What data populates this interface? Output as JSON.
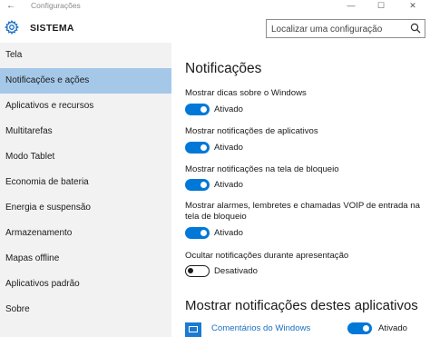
{
  "window": {
    "back_glyph": "←",
    "title": "Configurações",
    "minimize": "—",
    "maximize": "☐",
    "close": "✕"
  },
  "header": {
    "section": "SISTEMA",
    "search_placeholder": "Localizar uma configuração"
  },
  "sidebar": {
    "items": [
      {
        "label": "Tela"
      },
      {
        "label": "Notificações e ações"
      },
      {
        "label": "Aplicativos e recursos"
      },
      {
        "label": "Multitarefas"
      },
      {
        "label": "Modo Tablet"
      },
      {
        "label": "Economia de bateria"
      },
      {
        "label": "Energia e suspensão"
      },
      {
        "label": "Armazenamento"
      },
      {
        "label": "Mapas offline"
      },
      {
        "label": "Aplicativos padrão"
      },
      {
        "label": "Sobre"
      }
    ],
    "selected": "Notificações e ações"
  },
  "main": {
    "heading": "Notificações",
    "options": [
      {
        "label": "Mostrar dicas sobre o Windows",
        "state": "Ativado",
        "on": true
      },
      {
        "label": "Mostrar notificações de aplicativos",
        "state": "Ativado",
        "on": true
      },
      {
        "label": "Mostrar notificações na tela de bloqueio",
        "state": "Ativado",
        "on": true
      },
      {
        "label": "Mostrar alarmes, lembretes e chamadas VOIP de entrada na tela de bloqueio",
        "state": "Ativado",
        "on": true
      },
      {
        "label": "Ocultar notificações durante apresentação",
        "state": "Desativado",
        "on": false
      }
    ],
    "apps_heading": "Mostrar notificações destes aplicativos",
    "apps": [
      {
        "name": "Comentários do Windows",
        "state": "Ativado",
        "on": true
      }
    ]
  },
  "colors": {
    "accent": "#0078d7",
    "selected_item": "#a5c8e9",
    "sidebar_bg": "#f2f2f2",
    "link": "#1a6fc3"
  }
}
